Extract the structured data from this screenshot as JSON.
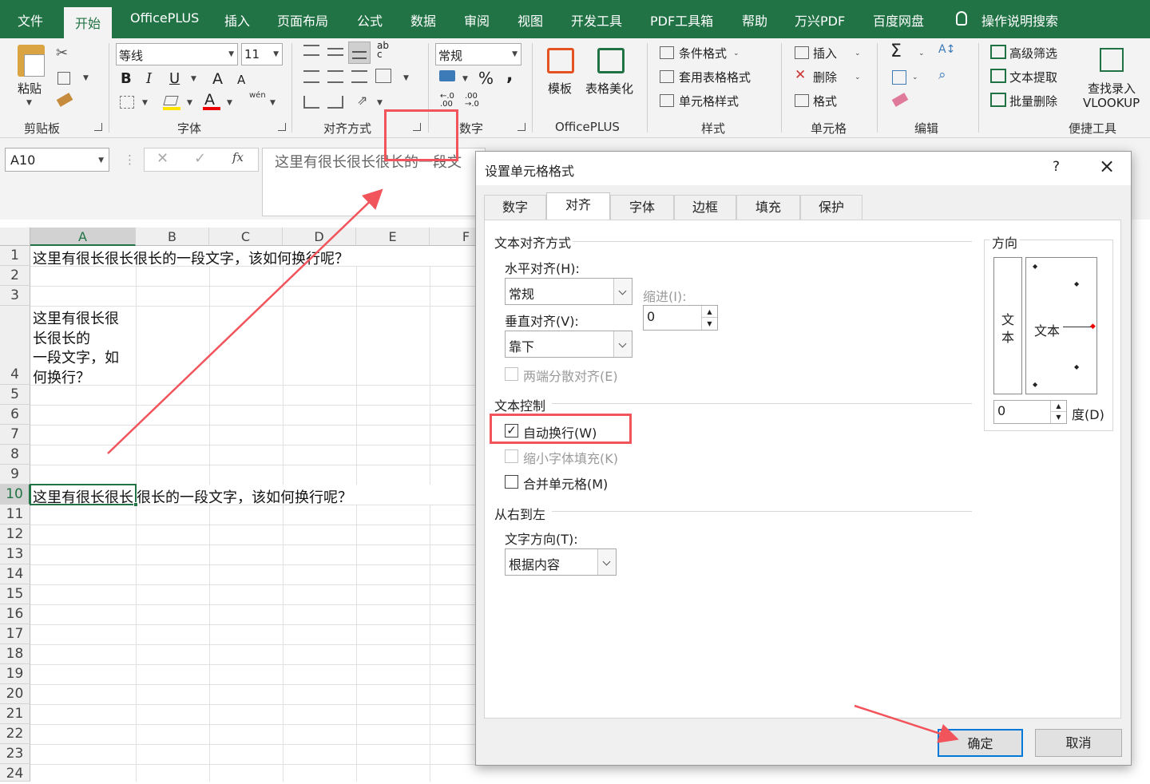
{
  "tabs": [
    "文件",
    "开始",
    "OfficePLUS",
    "插入",
    "页面布局",
    "公式",
    "数据",
    "审阅",
    "视图",
    "开发工具",
    "PDF工具箱",
    "帮助",
    "万兴PDF",
    "百度网盘",
    "操作说明搜索"
  ],
  "ribbon": {
    "clipboard": {
      "paste": "粘贴",
      "group": "剪贴板"
    },
    "font": {
      "name": "等线",
      "size": "11",
      "group": "字体",
      "bold": "B",
      "italic": "I",
      "underline": "U",
      "grow": "A",
      "shrink": "A",
      "wen": "wén"
    },
    "alignment": {
      "group": "对齐方式"
    },
    "number": {
      "format": "常规",
      "percent": "%",
      "comma": ",",
      "group": "数字"
    },
    "officeplus": {
      "template": "模板",
      "beautify": "表格美化",
      "group": "OfficePLUS"
    },
    "styles": {
      "conditional": "条件格式",
      "table_format": "套用表格格式",
      "cell_style": "单元格样式",
      "group": "样式"
    },
    "cells": {
      "insert": "插入",
      "delete": "删除",
      "format": "格式",
      "group": "单元格"
    },
    "editing": {
      "sum": "Σ",
      "group": "编辑"
    },
    "tools": {
      "advanced_filter": "高级筛选",
      "text_extract": "文本提取",
      "batch_delete": "批量删除",
      "lookup1": "查找录入",
      "lookup2": "VLOOKUP",
      "group": "便捷工具"
    }
  },
  "formula_bar": {
    "name_box": "A10",
    "fx": "fx",
    "content": "这里有很长很长很长的一段文"
  },
  "columns": [
    "A",
    "B",
    "C",
    "D",
    "E",
    "F"
  ],
  "rows": [
    "1",
    "2",
    "3",
    "4",
    "5",
    "6",
    "7",
    "8",
    "9",
    "10",
    "11",
    "12",
    "13",
    "14",
    "15",
    "16",
    "17",
    "18",
    "19",
    "20",
    "21",
    "22",
    "23",
    "24"
  ],
  "cells": {
    "r1": "这里有很长很长很长的一段文字，该如何换行呢？",
    "r4_l1": "这里有很长很",
    "r4_l2": "长很长的",
    "r4_l3": "一段文字，如",
    "r4_l4": "何换行？",
    "r10_a": "这里有很长很长",
    "r10_rest": "很长的一段文字，该如何换行呢？"
  },
  "dialog": {
    "title": "设置单元格格式",
    "help": "?",
    "close": "×",
    "tabs": [
      "数字",
      "对齐",
      "字体",
      "边框",
      "填充",
      "保护"
    ],
    "text_alignment": "文本对齐方式",
    "horizontal_label": "水平对齐(H):",
    "horizontal_value": "常规",
    "indent_label": "缩进(I):",
    "indent_value": "0",
    "vertical_label": "垂直对齐(V):",
    "vertical_value": "靠下",
    "justify_distributed": "两端分散对齐(E)",
    "text_control": "文本控制",
    "wrap_text": "自动换行(W)",
    "shrink_to_fit": "缩小字体填充(K)",
    "merge_cells": "合并单元格(M)",
    "rtl": "从右到左",
    "text_direction_label": "文字方向(T):",
    "text_direction_value": "根据内容",
    "orientation": "方向",
    "vertical_text1": "文",
    "vertical_text2": "本",
    "orient_text": "文本",
    "degree_value": "0",
    "degree_label": "度(D)",
    "ok": "确定",
    "cancel": "取消"
  },
  "colors": {
    "excel_green": "#217346",
    "highlight_red": "#f2545b"
  }
}
